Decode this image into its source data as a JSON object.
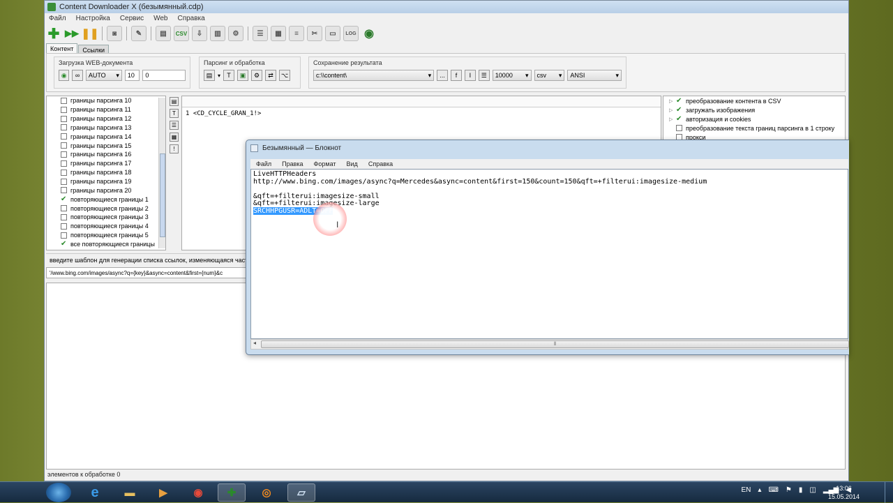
{
  "app": {
    "title": "Content Downloader X (безымянный.cdp)",
    "menu": [
      "Файл",
      "Настройка",
      "Сервис",
      "Web",
      "Справка"
    ],
    "tabs": [
      "Контент",
      "Ссылки"
    ],
    "groups": {
      "load": {
        "label": "Загрузка WEB-документа",
        "mode": "AUTO",
        "threads": "10",
        "delay": "0"
      },
      "parse": {
        "label": "Парсинг и обработка"
      },
      "save": {
        "label": "Сохранение результата",
        "path": "c:\\\\content\\",
        "dots_button": "...",
        "limit": "10000",
        "format": "csv",
        "encoding": "ANSI"
      }
    },
    "tree_items": [
      {
        "label": "границы парсинга 10",
        "checked": false
      },
      {
        "label": "границы парсинга 11",
        "checked": false
      },
      {
        "label": "границы парсинга 12",
        "checked": false
      },
      {
        "label": "границы парсинга 13",
        "checked": false
      },
      {
        "label": "границы парсинга 14",
        "checked": false
      },
      {
        "label": "границы парсинга 15",
        "checked": false
      },
      {
        "label": "границы парсинга 16",
        "checked": false
      },
      {
        "label": "границы парсинга 17",
        "checked": false
      },
      {
        "label": "границы парсинга 18",
        "checked": false
      },
      {
        "label": "границы парсинга 19",
        "checked": false
      },
      {
        "label": "границы парсинга 20",
        "checked": false
      },
      {
        "label": "повторяющиеся границы 1",
        "checked": true
      },
      {
        "label": "повторяющиеся границы 2",
        "checked": false
      },
      {
        "label": "повторяющиеся границы 3",
        "checked": false
      },
      {
        "label": "повторяющиеся границы 4",
        "checked": false
      },
      {
        "label": "повторяющиеся границы 5",
        "checked": false
      },
      {
        "label": "все повторяющиеся границы",
        "checked": true
      }
    ],
    "editor": {
      "line_no": "1",
      "code": "<CD_CYCLE_GRAN_1!>"
    },
    "right_items": [
      {
        "label": "преобразование контента в CSV",
        "checked": true
      },
      {
        "label": "загружать изображения",
        "checked": true
      },
      {
        "label": "авторизация и cookies",
        "checked": true
      },
      {
        "label": "преобразование текста границ парсинга в 1 строку",
        "checked": false
      },
      {
        "label": "прокси",
        "checked": false
      }
    ],
    "hint": "введите шаблон для генерации списка ссылок, изменяющаяся часть",
    "url_template": "'/www.bing.com/images/async?q={key}&async=content&first={num}&c",
    "status": "элементов к обработке 0"
  },
  "notepad": {
    "title": "Безымянный — Блокнот",
    "menu": [
      "Файл",
      "Правка",
      "Формат",
      "Вид",
      "Справка"
    ],
    "lines": [
      "LiveHTTPHeaders",
      "http://www.bing.com/images/async?q=Mercedes&async=content&first=150&count=150&qft=+filterui:imagesize-medium",
      "",
      "&qft=+filterui:imagesize-small",
      "&qft=+filterui:imagesize-large"
    ],
    "selected_line": "SRCHHPGUSR=ADLT=OFF"
  },
  "taskbar": {
    "lang": "EN",
    "time": "13:06",
    "date": "15.05.2014"
  },
  "colors": {
    "selection": "#3399ff",
    "check": "#2a8a2a",
    "taskbar": "#1c3350"
  }
}
